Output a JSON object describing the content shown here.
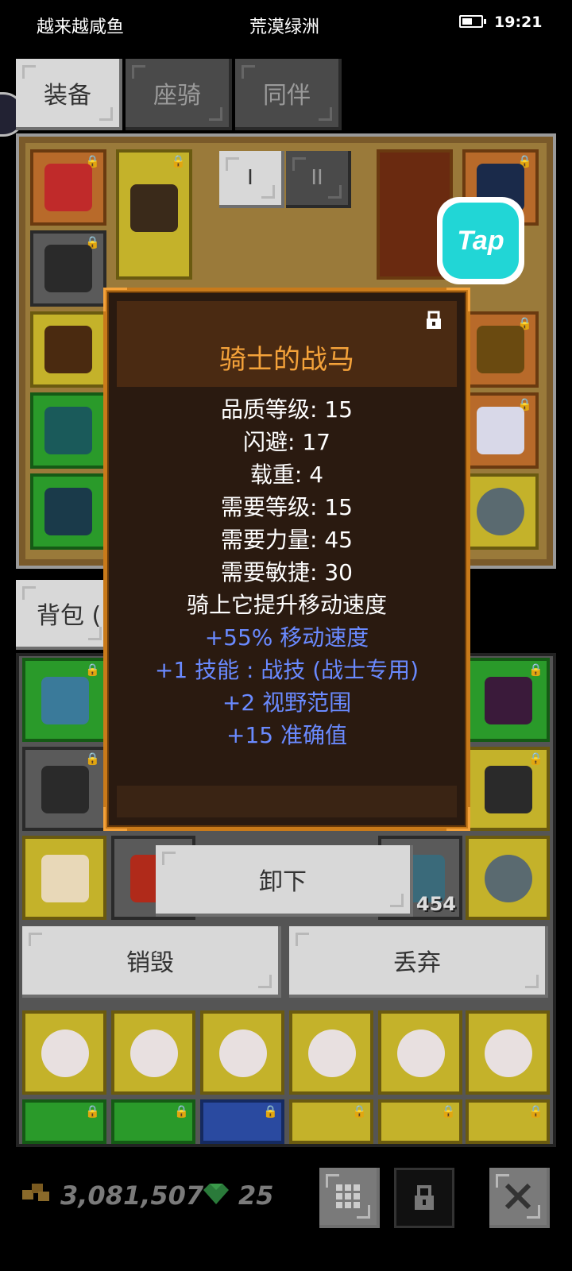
{
  "status_bar": {
    "left_label": "越来越咸鱼",
    "center_label": "荒漠绿洲",
    "time": "19:21"
  },
  "tabs": [
    {
      "label": "装备",
      "active": true
    },
    {
      "label": "座骑",
      "active": false
    },
    {
      "label": "同伴",
      "active": false
    }
  ],
  "sub_tabs": [
    {
      "label": "I"
    },
    {
      "label": "II"
    }
  ],
  "tap_badge": "Tap",
  "bag_tab_label": "背包 (",
  "tooltip": {
    "title": "骑士的战马",
    "stats": [
      "品质等级: 15",
      "闪避: 17",
      "载重: 4",
      "需要等级: 15",
      "需要力量: 45",
      "需要敏捷: 30",
      "骑上它提升移动速度"
    ],
    "bonuses": [
      "+55% 移动速度",
      "+1 技能 : 战技 (战士专用)",
      "+2 视野范围",
      "+15 准确值"
    ]
  },
  "actions": {
    "unequip": "卸下",
    "destroy": "销毁",
    "discard": "丢弃"
  },
  "bag_item_count": "454",
  "currency": {
    "gold": "3,081,507",
    "gems": "25"
  },
  "colors": {
    "title": "#f4a23a",
    "bonus": "#6a8aff",
    "frame": "#c97a1a"
  }
}
